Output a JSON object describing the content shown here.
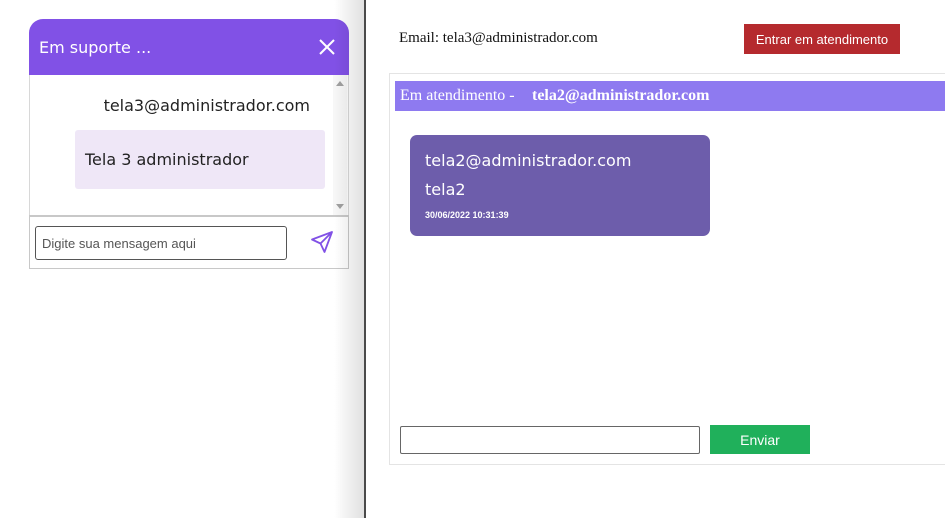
{
  "support_widget": {
    "title": "Em suporte ...",
    "sender_email": "tela3@administrador.com",
    "message_text": "Tela 3 administrador",
    "input_placeholder": "Digite sua mensagem aqui",
    "icons": {
      "close": "close-icon",
      "send": "send-icon"
    }
  },
  "agent_panel": {
    "email_line": "Email: tela3@administrador.com",
    "enter_button_label": "Entrar em atendimento",
    "chat_header_prefix": "Em atendimento -",
    "chat_header_email": "tela2@administrador.com",
    "messages": [
      {
        "sender": "tela2@administrador.com",
        "text": "tela2",
        "timestamp": "30/06/2022 10:31:39"
      }
    ],
    "message_input_value": "",
    "send_button_label": "Enviar"
  },
  "colors": {
    "widget_header": "#8151e6",
    "widget_bubble": "#efe7f7",
    "enter_button": "#b52a2e",
    "chat_header": "#8e7af0",
    "chat_message": "#6d5dab",
    "send_button": "#20b05b"
  }
}
